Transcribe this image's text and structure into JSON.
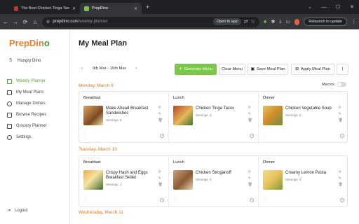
{
  "browser": {
    "tabs": [
      {
        "title": "The Best Chicken Tinga Tacos ..."
      },
      {
        "title": "PrepDino"
      }
    ],
    "url_host": "prepdino.com",
    "url_path": "/weekly-planner",
    "open_in_app": "Open in app",
    "relaunch": "Relaunch to update"
  },
  "app": {
    "logo_main": "PrepDin",
    "logo_accent": "o",
    "user_initial": "S",
    "user_name": "Hungry Dino",
    "menu": [
      {
        "label": "Weekly Planner"
      },
      {
        "label": "My Meal Plans"
      },
      {
        "label": "Manage Dishes"
      },
      {
        "label": "Browse Recipes"
      },
      {
        "label": "Grocery Planner"
      },
      {
        "label": "Settings"
      }
    ],
    "logout": "Logout"
  },
  "page": {
    "title": "My Meal Plan",
    "date_range": "9th Mar - 15th Mar",
    "buttons": {
      "generate": "Generate Menu",
      "clear": "Clear Menu",
      "save": "Save Meal Plan",
      "apply": "Apply Meal Plan"
    },
    "macros_label": "Macros"
  },
  "days": [
    {
      "title": "Monday, March 9",
      "slots": [
        {
          "label": "Breakfast",
          "meal": "Make Ahead Breakfast Sandwiches",
          "servings": "Servings: 6"
        },
        {
          "label": "Lunch",
          "meal": "Chicken Tinga Tacos",
          "servings": "Servings: 3"
        },
        {
          "label": "Dinner",
          "meal": "Chicken Vegetable Soup",
          "servings": "Servings: 6"
        }
      ]
    },
    {
      "title": "Tuesday, March 10",
      "slots": [
        {
          "label": "Breakfast",
          "meal": "Crispy Hash and Eggs Breakfast Skillet",
          "servings": "Servings: 1"
        },
        {
          "label": "Lunch",
          "meal": "Chicken Stroganoff",
          "servings": "Servings: 4"
        },
        {
          "label": "Dinner",
          "meal": "Creamy Lemon Pasta",
          "servings": "Servings: 4"
        }
      ]
    },
    {
      "title": "Wednesday, March 11"
    }
  ]
}
